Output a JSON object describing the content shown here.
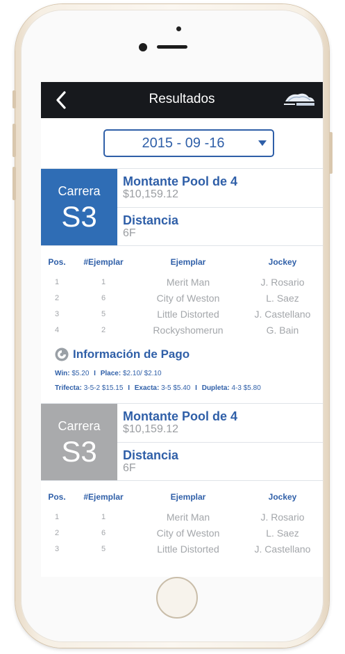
{
  "colors": {
    "accent": "#2f5fa8",
    "navbar": "#17191d",
    "badge_active": "#2f6db5",
    "badge_inactive": "#a9aaac"
  },
  "navbar": {
    "title": "Resultados",
    "back_icon": "chevron-left-icon",
    "logo": "camarero-logo"
  },
  "date_selector": {
    "value": "2015 - 09 -16",
    "caret_icon": "caret-down-icon"
  },
  "columns": {
    "pos": "Pos.",
    "num": "#Ejemplar",
    "name": "Ejemplar",
    "jockey": "Jockey"
  },
  "races": [
    {
      "badge_label": "Carrera",
      "badge_code": "S3",
      "pool_title": "Montante Pool de 4",
      "pool_value": "$10,159.12",
      "distance_title": "Distancia",
      "distance_value": "6F",
      "rows": [
        {
          "pos": "1",
          "num": "1",
          "name": "Merit Man",
          "jockey": "J. Rosario"
        },
        {
          "pos": "2",
          "num": "6",
          "name": "City of Weston",
          "jockey": "L. Saez"
        },
        {
          "pos": "3",
          "num": "5",
          "name": "Little Distorted",
          "jockey": "J. Castellano"
        },
        {
          "pos": "4",
          "num": "2",
          "name": "Rockyshomerun",
          "jockey": "G. Bain"
        }
      ],
      "payout": {
        "title": "Información de Pago",
        "win_label": "Win:",
        "win_value": "$5.20",
        "place_label": "Place:",
        "place_value": "$2.10/ $2.10",
        "trifecta_label": "Trifecta:",
        "trifecta_value": "3-5-2  $15.15",
        "exacta_label": "Exacta:",
        "exacta_value": "3-5 $5.40",
        "dupleta_label": "Dupleta:",
        "dupleta_value": "4-3 $5.80",
        "separator": "I"
      }
    },
    {
      "badge_label": "Carrera",
      "badge_code": "S3",
      "pool_title": "Montante Pool de 4",
      "pool_value": "$10,159.12",
      "distance_title": "Distancia",
      "distance_value": "6F",
      "rows": [
        {
          "pos": "1",
          "num": "1",
          "name": "Merit Man",
          "jockey": "J. Rosario"
        },
        {
          "pos": "2",
          "num": "6",
          "name": "City of Weston",
          "jockey": "L. Saez"
        },
        {
          "pos": "3",
          "num": "5",
          "name": "Little Distorted",
          "jockey": "J. Castellano"
        }
      ]
    }
  ]
}
